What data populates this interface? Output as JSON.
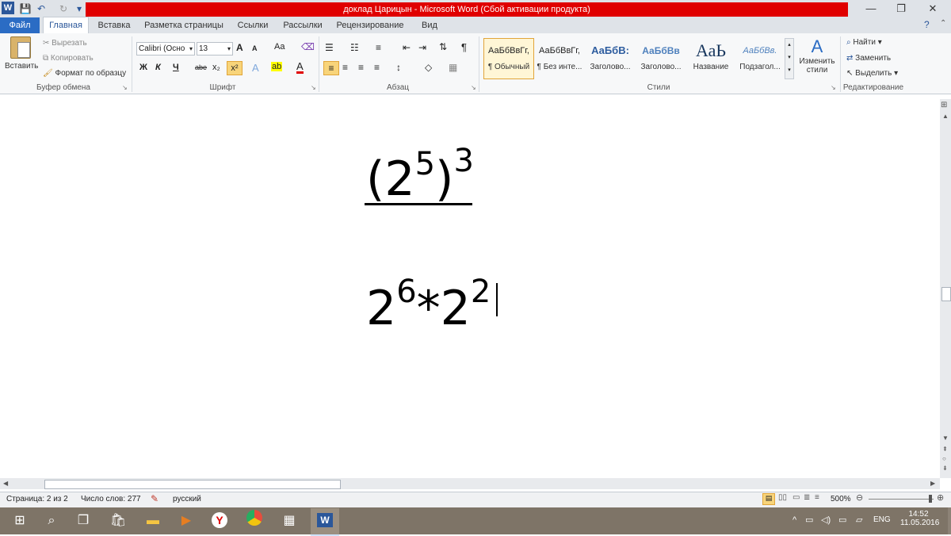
{
  "window": {
    "title": "доклад Царицын  -  Microsoft Word (Сбой активации продукта)",
    "app_icon": "W"
  },
  "tabs": [
    "Файл",
    "Главная",
    "Вставка",
    "Разметка страницы",
    "Ссылки",
    "Рассылки",
    "Рецензирование",
    "Вид"
  ],
  "clipboard": {
    "paste": "Вставить",
    "cut": "Вырезать",
    "copy": "Копировать",
    "format_painter": "Формат по образцу",
    "label": "Буфер обмена"
  },
  "font": {
    "name": "Calibri (Осно",
    "size": "13",
    "label": "Шрифт",
    "bold": "Ж",
    "italic": "К",
    "underline": "Ч",
    "strike": "abe",
    "sub": "x₂",
    "sup": "x²",
    "case": "Aa",
    "grow": "A",
    "shrink": "A"
  },
  "paragraph": {
    "label": "Абзац",
    "pilcrow": "¶"
  },
  "styles": {
    "label": "Стили",
    "items": [
      {
        "sample": "АаБбВвГг,",
        "name": "¶ Обычный"
      },
      {
        "sample": "АаБбВвГг,",
        "name": "¶ Без инте..."
      },
      {
        "sample": "АаБбВ:",
        "name": "Заголово..."
      },
      {
        "sample": "АаБбВв",
        "name": "Заголово..."
      },
      {
        "sample": "АаЬ",
        "name": "Название"
      },
      {
        "sample": "АаБбВв.",
        "name": "Подзагол..."
      }
    ],
    "change": "Изменить стили"
  },
  "editing": {
    "label": "Редактирование",
    "find": "Найти",
    "replace": "Заменить",
    "select": "Выделить"
  },
  "document": {
    "line1": {
      "base": "(2",
      "inner_exp": "5",
      "close": ")",
      "outer_exp": "3"
    },
    "line2": {
      "b1": "2",
      "e1": "6",
      "op": "*",
      "b2": "2",
      "e2": "2"
    }
  },
  "status": {
    "page": "Страница: 2 из 2",
    "words": "Число слов: 277",
    "language": "русский",
    "zoom": "500%"
  },
  "tray": {
    "lang": "ENG",
    "time": "14:52",
    "date": "11.05.2016"
  },
  "colors": {
    "accent": "#2b579a",
    "title_red": "#e00000",
    "taskbar": "#7e7467"
  }
}
